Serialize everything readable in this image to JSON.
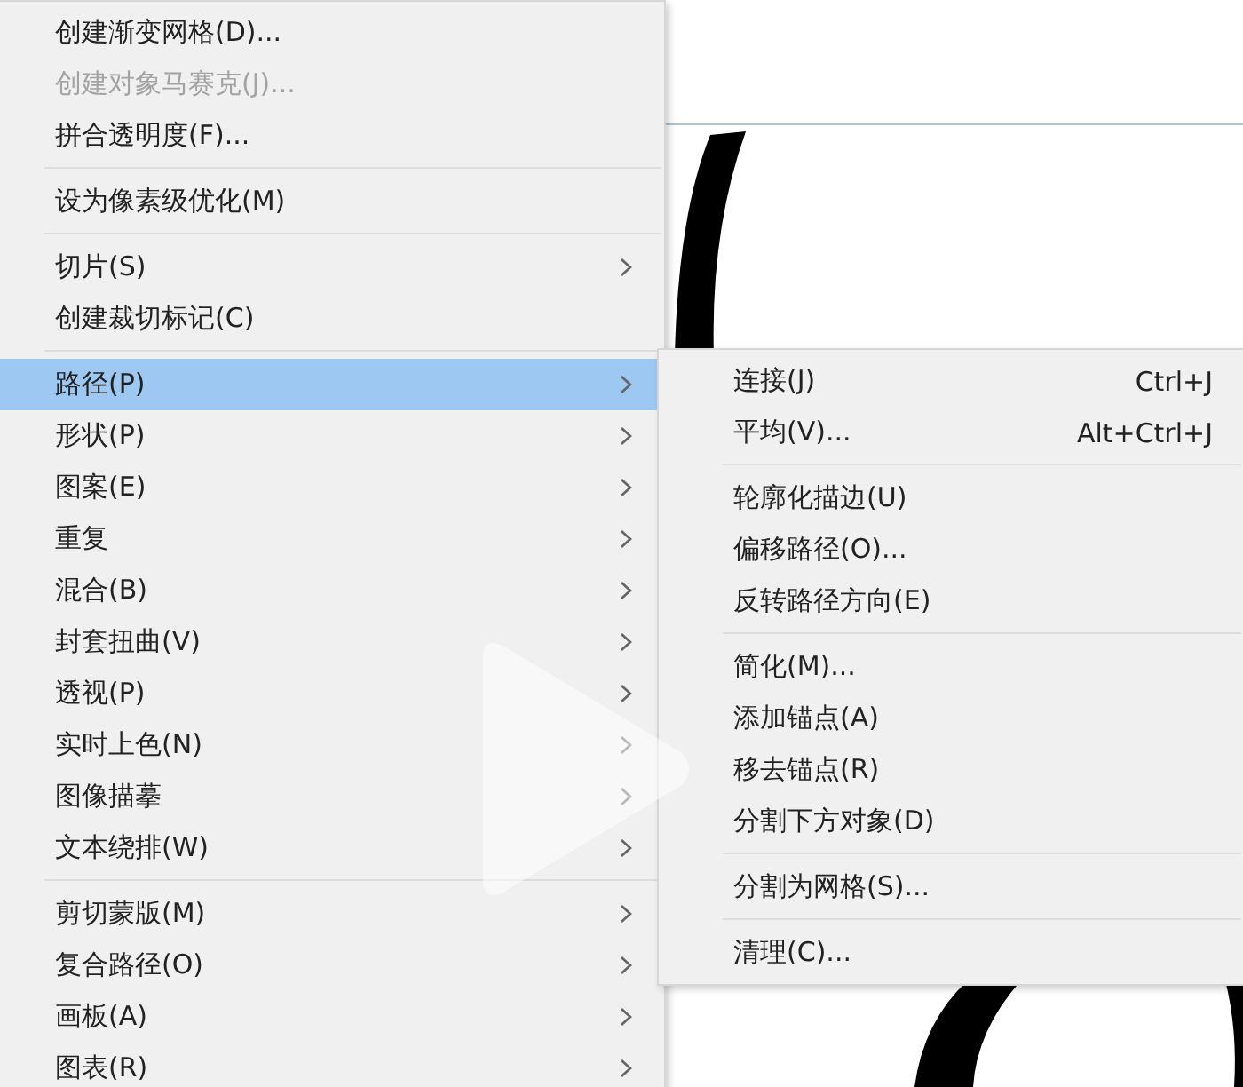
{
  "object_menu": {
    "items": [
      {
        "kind": "item",
        "label": "创建渐变网格(D)...",
        "disabled": false,
        "submenu": false,
        "selected": false
      },
      {
        "kind": "item",
        "label": "创建对象马赛克(J)...",
        "disabled": true,
        "submenu": false,
        "selected": false
      },
      {
        "kind": "item",
        "label": "拼合透明度(F)...",
        "disabled": false,
        "submenu": false,
        "selected": false
      },
      {
        "kind": "separator"
      },
      {
        "kind": "item",
        "label": "设为像素级优化(M)",
        "disabled": false,
        "submenu": false,
        "selected": false
      },
      {
        "kind": "separator"
      },
      {
        "kind": "item",
        "label": "切片(S)",
        "disabled": false,
        "submenu": true,
        "selected": false
      },
      {
        "kind": "item",
        "label": "创建裁切标记(C)",
        "disabled": false,
        "submenu": false,
        "selected": false
      },
      {
        "kind": "separator"
      },
      {
        "kind": "item",
        "label": "路径(P)",
        "disabled": false,
        "submenu": true,
        "selected": true
      },
      {
        "kind": "item",
        "label": "形状(P)",
        "disabled": false,
        "submenu": true,
        "selected": false
      },
      {
        "kind": "item",
        "label": "图案(E)",
        "disabled": false,
        "submenu": true,
        "selected": false
      },
      {
        "kind": "item",
        "label": "重复",
        "disabled": false,
        "submenu": true,
        "selected": false
      },
      {
        "kind": "item",
        "label": "混合(B)",
        "disabled": false,
        "submenu": true,
        "selected": false
      },
      {
        "kind": "item",
        "label": "封套扭曲(V)",
        "disabled": false,
        "submenu": true,
        "selected": false
      },
      {
        "kind": "item",
        "label": "透视(P)",
        "disabled": false,
        "submenu": true,
        "selected": false
      },
      {
        "kind": "item",
        "label": "实时上色(N)",
        "disabled": false,
        "submenu": true,
        "selected": false
      },
      {
        "kind": "item",
        "label": "图像描摹",
        "disabled": false,
        "submenu": true,
        "selected": false
      },
      {
        "kind": "item",
        "label": "文本绕排(W)",
        "disabled": false,
        "submenu": true,
        "selected": false
      },
      {
        "kind": "separator"
      },
      {
        "kind": "item",
        "label": "剪切蒙版(M)",
        "disabled": false,
        "submenu": true,
        "selected": false
      },
      {
        "kind": "item",
        "label": "复合路径(O)",
        "disabled": false,
        "submenu": true,
        "selected": false
      },
      {
        "kind": "item",
        "label": "画板(A)",
        "disabled": false,
        "submenu": true,
        "selected": false
      },
      {
        "kind": "item",
        "label": "图表(R)",
        "disabled": false,
        "submenu": true,
        "selected": false
      }
    ]
  },
  "path_submenu": {
    "items": [
      {
        "kind": "item",
        "label": "连接(J)",
        "shortcut": "Ctrl+J"
      },
      {
        "kind": "item",
        "label": "平均(V)...",
        "shortcut": "Alt+Ctrl+J"
      },
      {
        "kind": "separator"
      },
      {
        "kind": "item",
        "label": "轮廓化描边(U)"
      },
      {
        "kind": "item",
        "label": "偏移路径(O)..."
      },
      {
        "kind": "item",
        "label": "反转路径方向(E)"
      },
      {
        "kind": "separator"
      },
      {
        "kind": "item",
        "label": "简化(M)..."
      },
      {
        "kind": "item",
        "label": "添加锚点(A)"
      },
      {
        "kind": "item",
        "label": "移去锚点(R)"
      },
      {
        "kind": "item",
        "label": "分割下方对象(D)"
      },
      {
        "kind": "separator"
      },
      {
        "kind": "item",
        "label": "分割为网格(S)..."
      },
      {
        "kind": "separator"
      },
      {
        "kind": "item",
        "label": "清理(C)..."
      }
    ]
  }
}
